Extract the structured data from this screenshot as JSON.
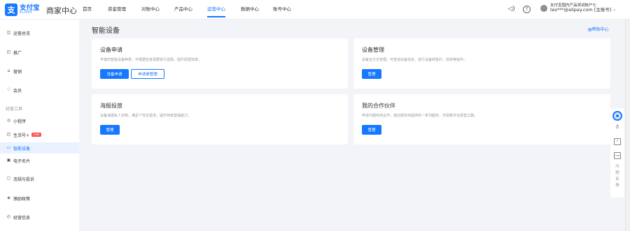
{
  "header": {
    "logo_mark": "支",
    "logo_cn": "支付宝",
    "logo_en": "ALIPAY",
    "brand_title": "商家中心",
    "nav": [
      {
        "label": "首页"
      },
      {
        "label": "资金管理"
      },
      {
        "label": "对账中心"
      },
      {
        "label": "产品中心"
      },
      {
        "label": "运营中心",
        "active": true
      },
      {
        "label": "数据中心"
      },
      {
        "label": "账号中心"
      }
    ],
    "user_name": "支付宝国内产品测试帐户七",
    "user_account": "tes***@alipay.com [主账号]",
    "help_icon_glyph": "?",
    "speaker_icon_glyph": "◁)",
    "caret_glyph": "⌄"
  },
  "sidebar": {
    "items": [
      {
        "label": "运营总览",
        "icon": "◫"
      },
      {
        "label": "推广",
        "icon": "◰"
      },
      {
        "label": "营销",
        "icon": "⌂"
      },
      {
        "label": "会员",
        "icon": "♡"
      }
    ],
    "group_label": "经营工具",
    "tools": [
      {
        "label": "小程序",
        "icon": "◎"
      },
      {
        "label": "生活号+",
        "icon": "◰",
        "badge": "new"
      },
      {
        "label": "智能设备",
        "icon": "▭",
        "active": true
      },
      {
        "label": "电子名片",
        "icon": "▣"
      },
      {
        "label": "违规与投诉",
        "icon": "▢"
      },
      {
        "label": "激励政策",
        "icon": "◈"
      },
      {
        "label": "经营信息",
        "icon": "◴"
      }
    ]
  },
  "main": {
    "title": "智能设备",
    "help_link": "帮助中心",
    "help_icon_glyph": "▤",
    "cards": [
      {
        "title": "设备申请",
        "desc": "丰富的智能设备种类，可根据自身需要进行选择，提升经营效率。",
        "buttons": [
          {
            "label": "设备申请",
            "style": "primary"
          },
          {
            "label": "申请单管理",
            "style": "outline"
          }
        ]
      },
      {
        "title": "设备管理",
        "desc": "设备全方位管理，可查询设备信息、进行设备转签约、授权等操作。",
        "buttons": [
          {
            "label": "管理",
            "style": "primary"
          }
        ]
      },
      {
        "title": "海报投放",
        "desc": "设备海报私人定制，满足个性化需求，提升商家营销能力。",
        "buttons": [
          {
            "label": "管理",
            "style": "primary"
          }
        ]
      },
      {
        "title": "我的合作伙伴",
        "desc": "申请与服务商合作，通过服务商提供的一系列服务，开启数字化经营之路。",
        "buttons": [
          {
            "label": "管理",
            "style": "primary"
          }
        ]
      }
    ]
  },
  "rail": {
    "headset_glyph": "♁",
    "box_glyph": "?",
    "new_glyph": "new",
    "feedback": [
      "问",
      "题",
      "反",
      "馈"
    ]
  },
  "colors": {
    "accent": "#1677ff",
    "page_bg": "#f3f4f7",
    "badge": "#ff4d4f"
  }
}
